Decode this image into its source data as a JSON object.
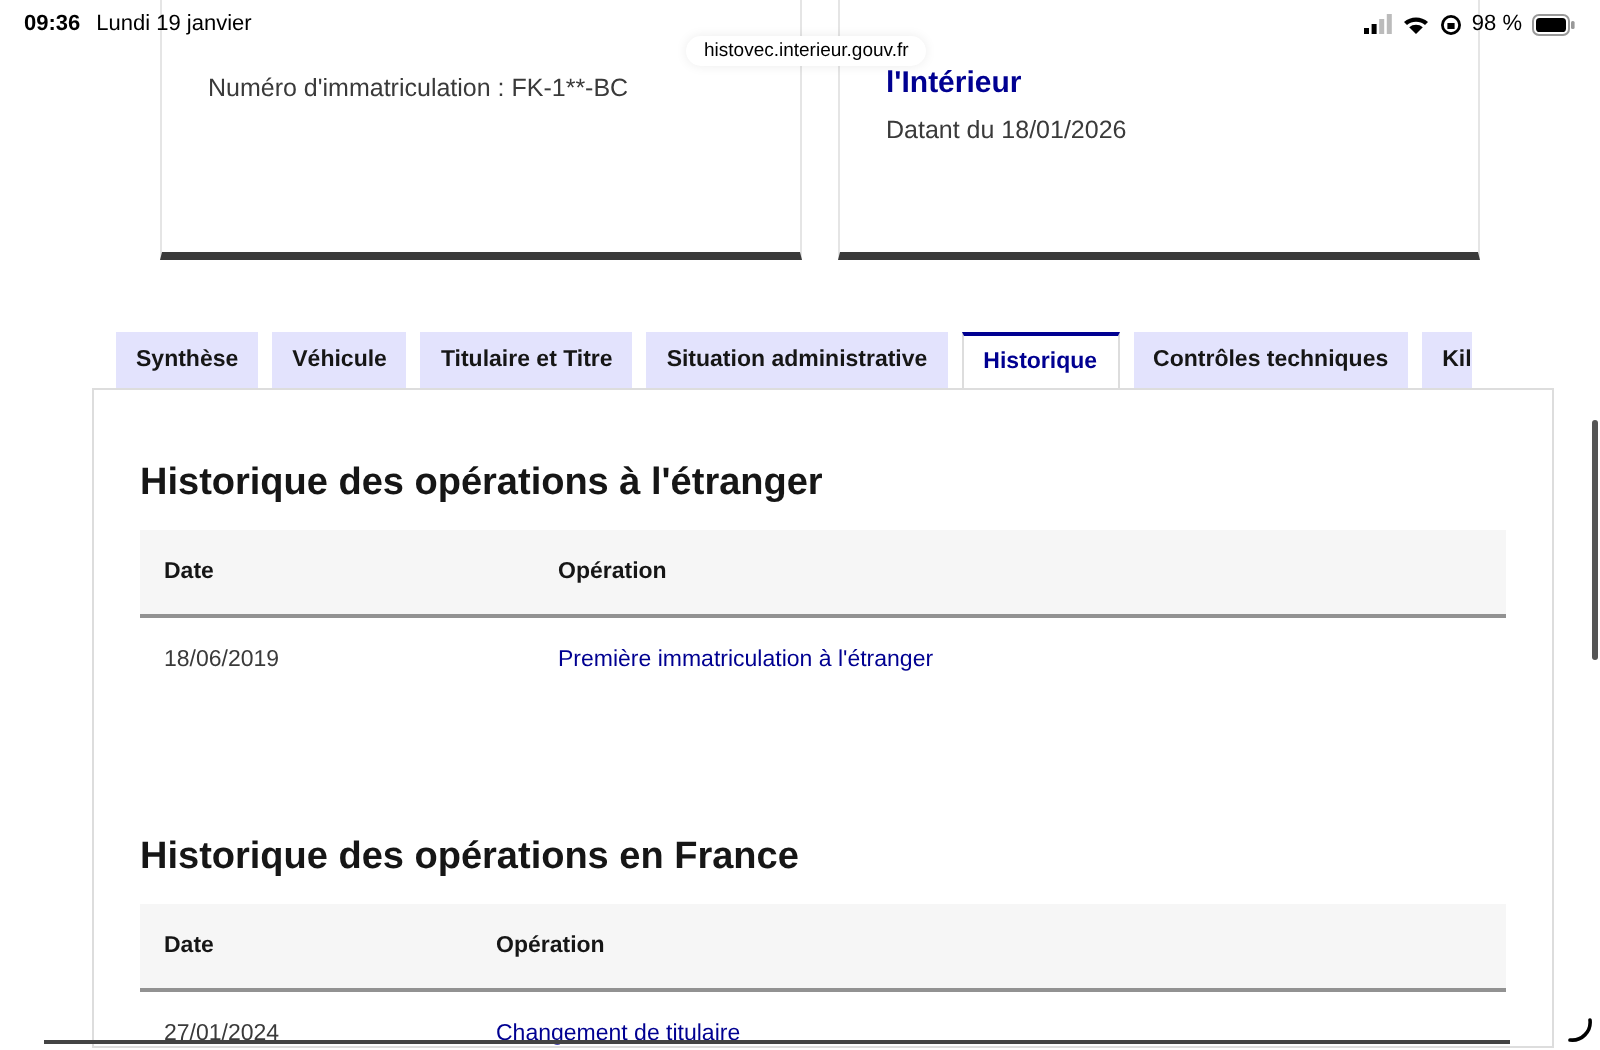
{
  "status_bar": {
    "time": "09:36",
    "date": "Lundi 19 janvier",
    "battery": "98 %"
  },
  "address_bar": {
    "url": "histovec.interieur.gouv.fr"
  },
  "cards": [
    {
      "text": "Numéro d'immatriculation : FK-1**-BC"
    },
    {
      "title": "l'Intérieur",
      "text": "Datant du 18/01/2026"
    }
  ],
  "tabs": [
    {
      "label": "Synthèse",
      "selected": false
    },
    {
      "label": "Véhicule",
      "selected": false
    },
    {
      "label": "Titulaire et Titre",
      "selected": false
    },
    {
      "label": "Situation administrative",
      "selected": false
    },
    {
      "label": "Historique",
      "selected": true
    },
    {
      "label": "Contrôles techniques",
      "selected": false
    },
    {
      "label": "Kil",
      "selected": false
    }
  ],
  "sections": [
    {
      "title": "Historique des opérations à l'étranger",
      "columns": [
        "Date",
        "Opération"
      ],
      "rows": [
        {
          "date": "18/06/2019",
          "operation": "Première immatriculation à l'étranger"
        }
      ]
    },
    {
      "title": "Historique des opérations en France",
      "columns": [
        "Date",
        "Opération"
      ],
      "rows": [
        {
          "date": "27/01/2024",
          "operation": "Changement de titulaire"
        }
      ]
    }
  ]
}
